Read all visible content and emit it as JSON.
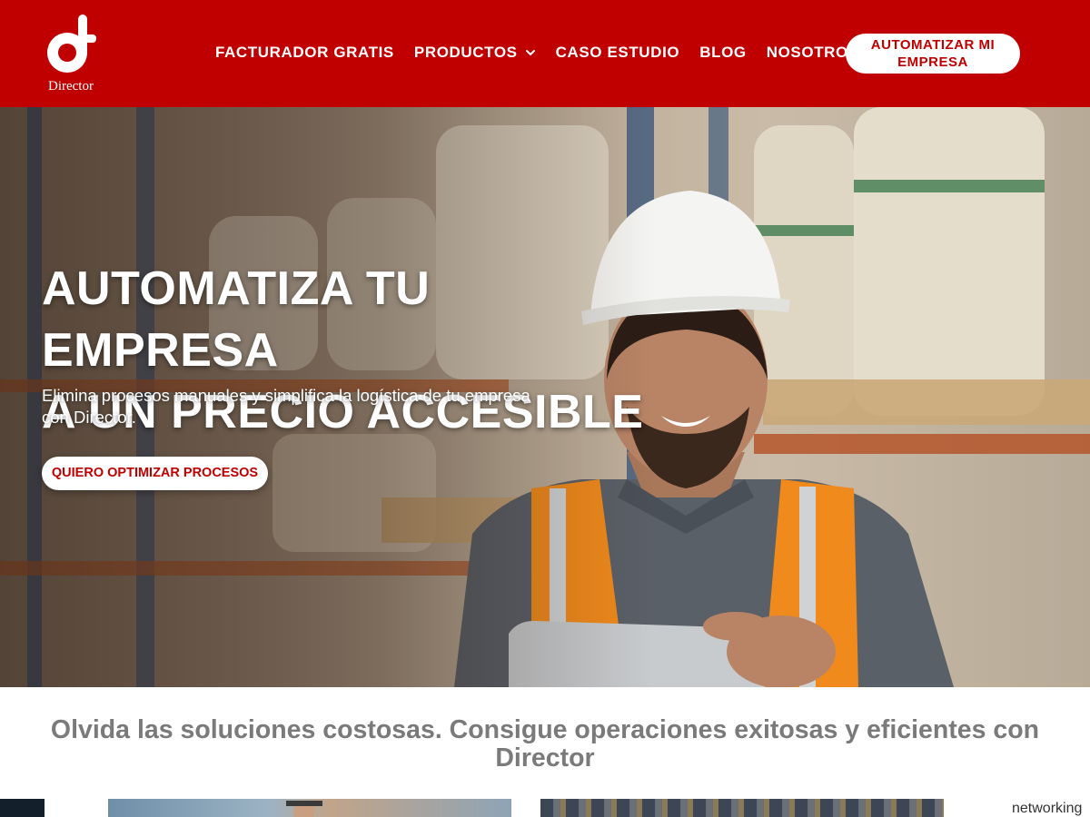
{
  "brand": {
    "logo_text": "Director",
    "primary_color": "#c00000"
  },
  "nav": {
    "items": [
      {
        "label": "FACTURADOR GRATIS",
        "has_dropdown": false
      },
      {
        "label": "PRODUCTOS",
        "has_dropdown": true
      },
      {
        "label": "CASO ESTUDIO",
        "has_dropdown": false
      },
      {
        "label": "BLOG",
        "has_dropdown": false
      },
      {
        "label": "NOSOTROS",
        "has_dropdown": false
      }
    ],
    "cta_label": "AUTOMATIZAR MI EMPRESA"
  },
  "hero": {
    "title_line1": "AUTOMATIZA TU EMPRESA",
    "title_line2": "A UN PRECIO ACCESIBLE",
    "subtitle": "Elimina procesos manuales y simplifica la logística de tu empresa con Director.",
    "cta_label": "QUIERO OPTIMIZAR PROCESOS"
  },
  "section": {
    "tagline": "Olvida las soluciones costosas. Consigue operaciones exitosas y eficientes con Director"
  },
  "cards": {
    "side_label": "networking"
  }
}
